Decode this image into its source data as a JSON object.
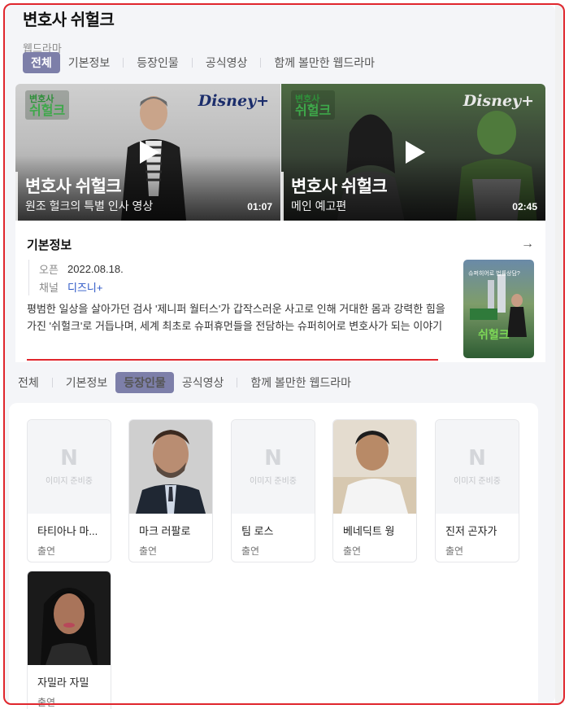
{
  "header": {
    "title": "변호사 쉬헐크",
    "subtitle": "웹드라마"
  },
  "tabs": [
    "전체",
    "기본정보",
    "등장인물",
    "공식영상",
    "함께 볼만한 웹드라마"
  ],
  "videos": [
    {
      "logo_small": "변호사",
      "logo_big": "쉬헐크",
      "brand": "Disney+",
      "title": "변호사 쉬헐크",
      "subtitle": "원조 헐크의 특별 인사 영상",
      "duration": "01:07"
    },
    {
      "logo_small": "변호사",
      "logo_big": "쉬헐크",
      "brand": "Disney+",
      "title": "변호사 쉬헐크",
      "subtitle": "메인 예고편",
      "duration": "02:45"
    }
  ],
  "info": {
    "heading": "기본정보",
    "arrow": "→",
    "open_key": "오픈",
    "open_val": "2022.08.18.",
    "channel_key": "채널",
    "channel_val": "디즈니+",
    "description": "평범한 일상을 살아가던 검사 '제니퍼 월터스'가 갑작스러운 사고로 인해 거대한 몸과 강력한 힘을 가진 '쉬헐크'로 거듭나며, 세계 최초로 슈퍼휴먼들을 전담하는 슈퍼히어로 변호사가 되는 이야기",
    "poster_text": "슈퍼히어로 법률상담?",
    "poster_logo": "쉬헐크"
  },
  "placeholder": {
    "letter": "N",
    "text": "이미지 준비중"
  },
  "cast": [
    {
      "name": "타티아나 마...",
      "role": "출연",
      "photo": "placeholder"
    },
    {
      "name": "마크 러팔로",
      "role": "출연",
      "photo": "man-beard"
    },
    {
      "name": "팀 로스",
      "role": "출연",
      "photo": "placeholder"
    },
    {
      "name": "베네딕트 웡",
      "role": "출연",
      "photo": "man-smile"
    },
    {
      "name": "진저 곤자가",
      "role": "출연",
      "photo": "placeholder"
    },
    {
      "name": "자밀라 자밀",
      "role": "출연",
      "photo": "woman"
    }
  ],
  "colors": {
    "accent_tab": "#7d7fa9",
    "link": "#2a55c6",
    "highlight": "#e0262d"
  }
}
